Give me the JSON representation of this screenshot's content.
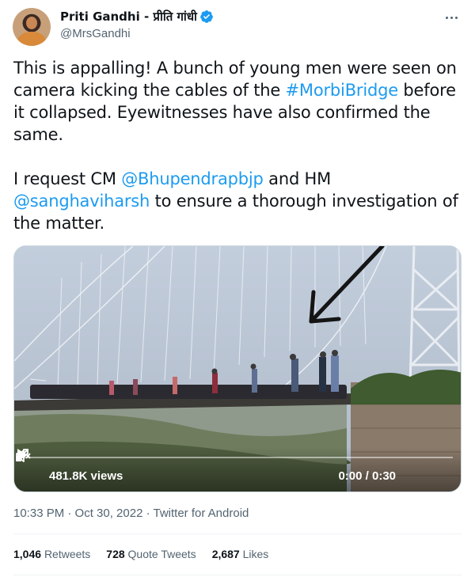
{
  "author": {
    "display_name": "Priti Gandhi - प्रीति गांधी",
    "handle": "@MrsGandhi",
    "verified_color": "#1d9bf0"
  },
  "tweet": {
    "para1_a": "This is appalling! A bunch of young men were seen on camera kicking the cables of the ",
    "hashtag": "#MorbiBridge",
    "para1_b": " before it collapsed. Eyewitnesses have also confirmed the same.",
    "para2_a": "I request CM ",
    "mention1": "@Bhupendrapbjp",
    "para2_b": " and HM ",
    "mention2": "@sanghaviharsh",
    "para2_c": " to ensure a thorough investigation of the matter."
  },
  "video": {
    "views": "481.8K views",
    "timecode": "0:00 / 0:30",
    "progress": 0.0
  },
  "meta": {
    "time": "10:33 PM · Oct 30, 2022 · ",
    "app": "Twitter for Android"
  },
  "stats": {
    "retweets_count": "1,046",
    "retweets_label": "Retweets",
    "quotes_count": "728",
    "quotes_label": "Quote Tweets",
    "likes_count": "2,687",
    "likes_label": "Likes"
  },
  "colors": {
    "link": "#1d9bf0",
    "muted": "#536471",
    "text": "#0f1419"
  }
}
